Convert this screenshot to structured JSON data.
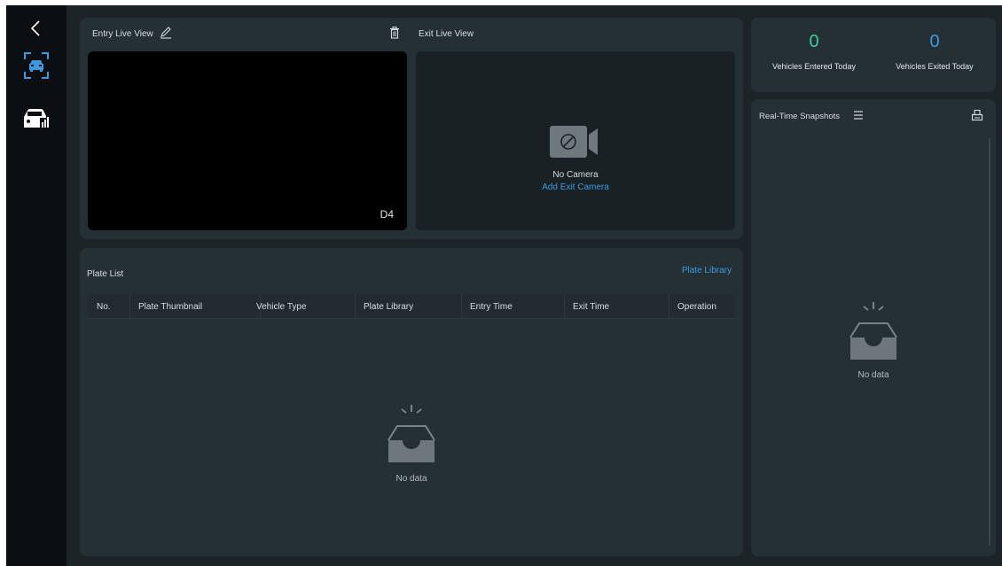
{
  "sidebar": {
    "back_icon": "chevron-left-icon",
    "items": [
      {
        "icon": "lpr-camera-icon",
        "active": true,
        "color": "#3b9ae1"
      },
      {
        "icon": "vehicle-stats-icon",
        "active": false,
        "color": "#ffffff"
      }
    ]
  },
  "live": {
    "entry_title": "Entry Live View",
    "exit_title": "Exit Live View",
    "entry_channel": "D4",
    "no_camera": "No Camera",
    "add_exit_camera": "Add Exit Camera"
  },
  "plate_list": {
    "title": "Plate List",
    "library_link": "Plate Library",
    "columns": [
      "No.",
      "Plate Thumbnail",
      "Vehicle Type",
      "Plate Library",
      "Entry Time",
      "Exit Time",
      "Operation"
    ],
    "rows": [],
    "empty_text": "No data"
  },
  "stats": {
    "entered_value": "0",
    "entered_label": "Vehicles Entered Today",
    "entered_color": "#3ccf9a",
    "exited_value": "0",
    "exited_label": "Vehicles Exited Today",
    "exited_color": "#3b9ae1"
  },
  "snapshots": {
    "title": "Real-Time Snapshots",
    "empty_text": "No data"
  },
  "colors": {
    "accent": "#3b9ae1",
    "background": "#1d2428",
    "panel": "#253034",
    "sidebar": "#0b0f11"
  }
}
